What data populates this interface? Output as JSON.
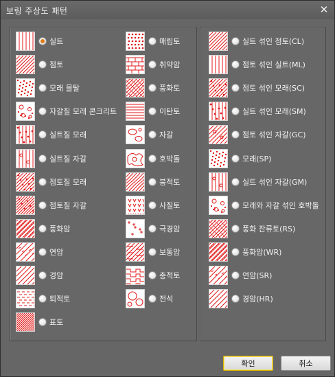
{
  "dialog": {
    "title": "보링 주상도 패턴",
    "close_glyph": "✕",
    "ok_label": "확인",
    "cancel_label": "취소"
  },
  "selected_pattern": "실트",
  "left_col1": [
    {
      "label": "실트",
      "pattern": "vlines",
      "checked": true
    },
    {
      "label": "점토",
      "pattern": "diag"
    },
    {
      "label": "모래 몰탈",
      "pattern": "dots"
    },
    {
      "label": "자갈질 모래 콘크리트",
      "pattern": "circles"
    },
    {
      "label": "실트질 모래",
      "pattern": "vlines-dots"
    },
    {
      "label": "실트질 자갈",
      "pattern": "vlines-circles"
    },
    {
      "label": "점토질 모래",
      "pattern": "diag-dots"
    },
    {
      "label": "점토질 자갈",
      "pattern": "diag-dense"
    },
    {
      "label": "풍화암",
      "pattern": "diag-double"
    },
    {
      "label": "연암",
      "pattern": "diag-marks"
    },
    {
      "label": "경암",
      "pattern": "diag-wide"
    },
    {
      "label": "퇴적토",
      "pattern": "dashes"
    },
    {
      "label": "표토",
      "pattern": "diag-fine"
    }
  ],
  "left_col2": [
    {
      "label": "매립토",
      "pattern": "cross-dots"
    },
    {
      "label": "취약암",
      "pattern": "bricks"
    },
    {
      "label": "풍화토",
      "pattern": "diag-cross"
    },
    {
      "label": "이탄토",
      "pattern": "hlines"
    },
    {
      "label": "자갈",
      "pattern": "pebbles"
    },
    {
      "label": "호박돌",
      "pattern": "boulders"
    },
    {
      "label": "붕적토",
      "pattern": "wavy-diag"
    },
    {
      "label": "사질토",
      "pattern": "ticks"
    },
    {
      "label": "극경암",
      "pattern": "plus"
    },
    {
      "label": "보통암",
      "pattern": "diag-steps"
    },
    {
      "label": "충적토",
      "pattern": "steps"
    },
    {
      "label": "전석",
      "pattern": "big-circles"
    }
  ],
  "right_col": [
    {
      "label": "실트 섞인 점토(CL)",
      "pattern": "diag"
    },
    {
      "label": "점토 섞인 실트(ML)",
      "pattern": "vlines"
    },
    {
      "label": "점토 섞인 모래(SC)",
      "pattern": "diag-dots"
    },
    {
      "label": "실트 섞인 모래(SM)",
      "pattern": "vlines-dots"
    },
    {
      "label": "점토 섞인 자갈(GC)",
      "pattern": "diag-circles"
    },
    {
      "label": "모래(SP)",
      "pattern": "dots"
    },
    {
      "label": "실트 섞인 자갈(GM)",
      "pattern": "vlines-circles"
    },
    {
      "label": "모래와 자갈 섞인 호박돌",
      "pattern": "circles"
    },
    {
      "label": "풍화 잔류토(RS)",
      "pattern": "diag-cross"
    },
    {
      "label": "풍화암(WR)",
      "pattern": "diag-double"
    },
    {
      "label": "연암(SR)",
      "pattern": "diag-marks"
    },
    {
      "label": "경암(HR)",
      "pattern": "diag-wide"
    }
  ]
}
